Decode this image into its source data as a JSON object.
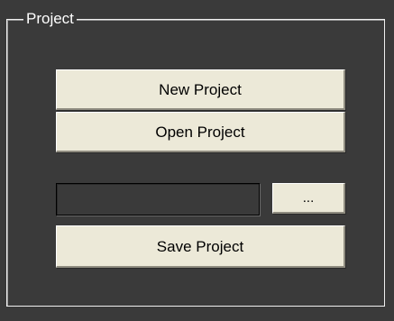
{
  "project_group": {
    "title": "Project",
    "new_project_label": "New Project",
    "open_project_label": "Open Project",
    "path_value": "",
    "browse_label": "...",
    "save_project_label": "Save Project"
  },
  "colors": {
    "background": "#3a3a3a",
    "button_face": "#ece9d8",
    "frame": "#f0f0f0",
    "title_text": "#ffffff"
  }
}
